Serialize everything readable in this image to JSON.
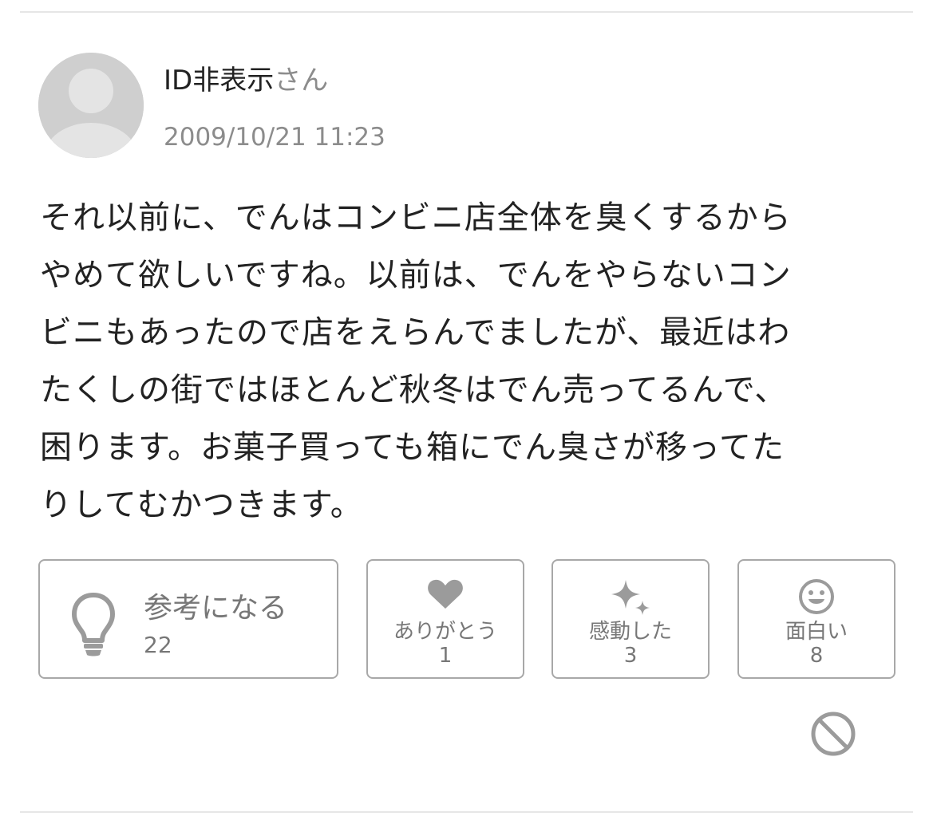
{
  "answer": {
    "author": {
      "name": "ID非表示",
      "suffix": "さん",
      "avatar_icon": "default-user-avatar-icon"
    },
    "timestamp": "2009/10/21 11:23",
    "body_lines": [
      "それ以前に、でんはコンビニ店全体を臭くするから",
      "やめて欲しいですね。以前は、でんをやらないコン",
      "ビニもあったので店をえらんでましたが、最近はわ",
      "たくしの街ではほとんど秋冬はでん売ってるんで、",
      "困ります。お菓子買っても箱にでん臭さが移ってた",
      "りしてむかつきます。"
    ]
  },
  "reactions": {
    "helpful": {
      "label": "参考になる",
      "count": "22",
      "icon": "lightbulb-icon"
    },
    "thanks": {
      "label": "ありがとう",
      "count": "1",
      "icon": "heart-icon"
    },
    "moved": {
      "label": "感動した",
      "count": "3",
      "icon": "sparkle-icon"
    },
    "funny": {
      "label": "面白い",
      "count": "8",
      "icon": "smiley-icon"
    }
  },
  "report": {
    "icon": "block-icon"
  },
  "colors": {
    "text_primary": "#222222",
    "text_secondary": "#8c8c8c",
    "icon_gray": "#9b9b9b",
    "border": "#a8a8a8",
    "divider": "#e6e6e6",
    "avatar_bg": "#cfcfcf"
  }
}
